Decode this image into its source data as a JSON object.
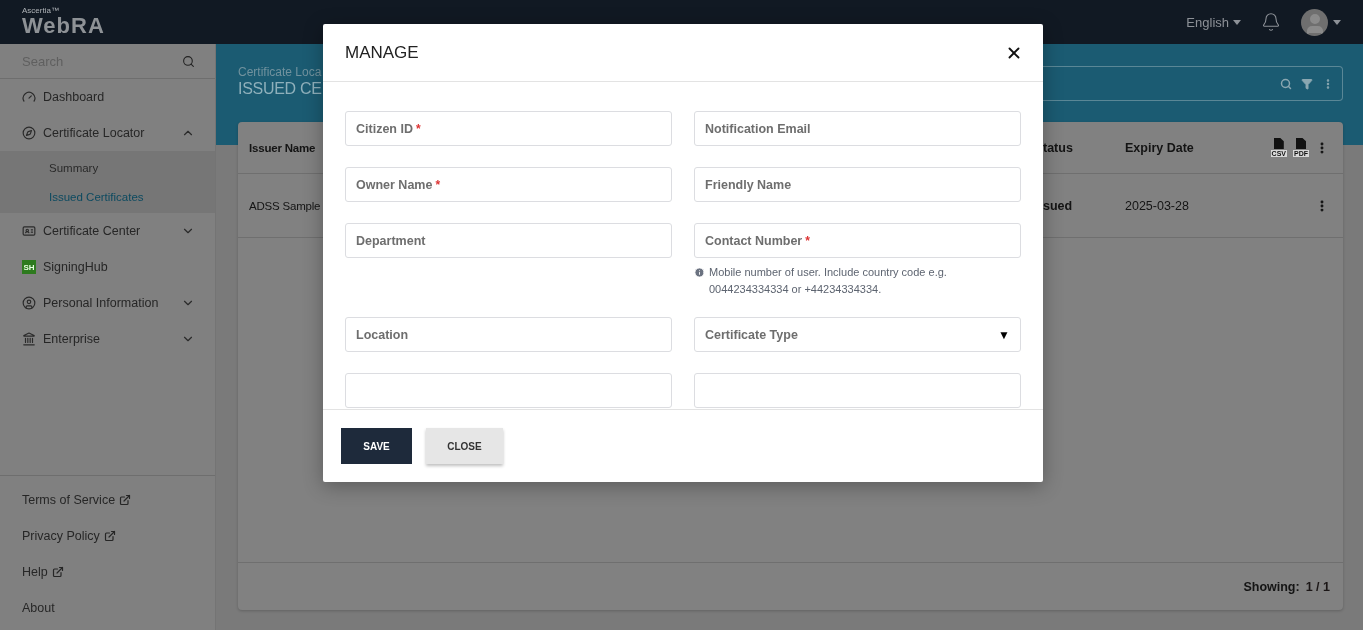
{
  "topbar": {
    "brand": "Ascertia™",
    "product": "WebRA",
    "language": "English"
  },
  "sidebar": {
    "search": {
      "placeholder": "Search"
    },
    "items": [
      {
        "label": "Dashboard",
        "kind": "link"
      },
      {
        "label": "Certificate Locator",
        "kind": "group",
        "expanded": true,
        "children": [
          {
            "label": "Summary",
            "selected": false
          },
          {
            "label": "Issued Certificates",
            "selected": true
          }
        ]
      },
      {
        "label": "Certificate Center",
        "kind": "group",
        "expanded": false
      },
      {
        "label": "SigningHub",
        "kind": "link",
        "badge": "SH"
      },
      {
        "label": "Personal Information",
        "kind": "group",
        "expanded": false
      },
      {
        "label": "Enterprise",
        "kind": "group",
        "expanded": false
      }
    ],
    "footer_links": [
      {
        "label": "Terms of Service",
        "external": true
      },
      {
        "label": "Privacy Policy",
        "external": true
      },
      {
        "label": "Help",
        "external": true
      },
      {
        "label": "About",
        "external": false
      }
    ]
  },
  "page": {
    "breadcrumb": "Certificate Loca",
    "title": "ISSUED CE"
  },
  "table": {
    "columns_left": [
      "Issuer Name"
    ],
    "columns_right": [
      "tatus",
      "Expiry Date"
    ],
    "export_icons": [
      "CSV",
      "PDF"
    ],
    "rows": [
      {
        "left": [
          "ADSS Sample"
        ],
        "right": [
          "sued",
          "2025-03-28"
        ]
      }
    ],
    "showing_label": "Showing:",
    "showing_value": "1 / 1"
  },
  "modal": {
    "title": "MANAGE",
    "required_mark": "*",
    "fields": [
      {
        "kind": "input",
        "label": "Citizen ID",
        "required": true
      },
      {
        "kind": "input",
        "label": "Notification Email",
        "required": false
      },
      {
        "kind": "input",
        "label": "Owner Name",
        "required": true
      },
      {
        "kind": "input",
        "label": "Friendly Name",
        "required": false
      },
      {
        "kind": "input",
        "label": "Department",
        "required": false
      },
      {
        "kind": "input",
        "label": "Contact Number",
        "required": true,
        "hint": "Mobile number of user. Include country code e.g. 0044234334334 or +44234334334."
      },
      {
        "kind": "input",
        "label": "Location",
        "required": false
      },
      {
        "kind": "select",
        "label": "Certificate Type",
        "required": false,
        "arrow": "▼"
      },
      {
        "kind": "cut"
      },
      {
        "kind": "cut"
      }
    ],
    "buttons": [
      {
        "label": "SAVE",
        "kind": "primary"
      },
      {
        "label": "CLOSE",
        "kind": "secondary"
      }
    ]
  }
}
